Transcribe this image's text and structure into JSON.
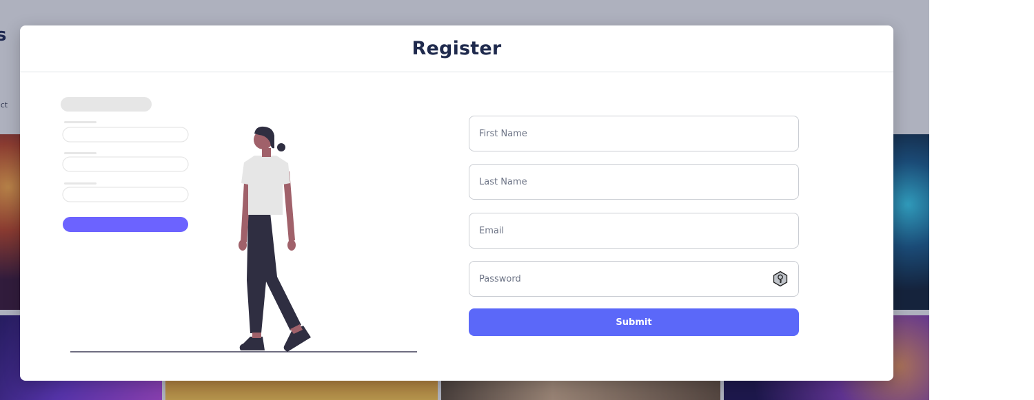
{
  "background": {
    "logo_text": "s",
    "sub_text": "act"
  },
  "modal": {
    "title": "Register"
  },
  "form": {
    "first_name_placeholder": "First Name",
    "last_name_placeholder": "Last Name",
    "email_placeholder": "Email",
    "password_placeholder": "Password",
    "password_icon": "key-lock-icon",
    "submit_label": "Submit"
  },
  "colors": {
    "accent": "#5b68f9",
    "title": "#1f2a4d",
    "illustration_accent": "#6c63ff"
  }
}
